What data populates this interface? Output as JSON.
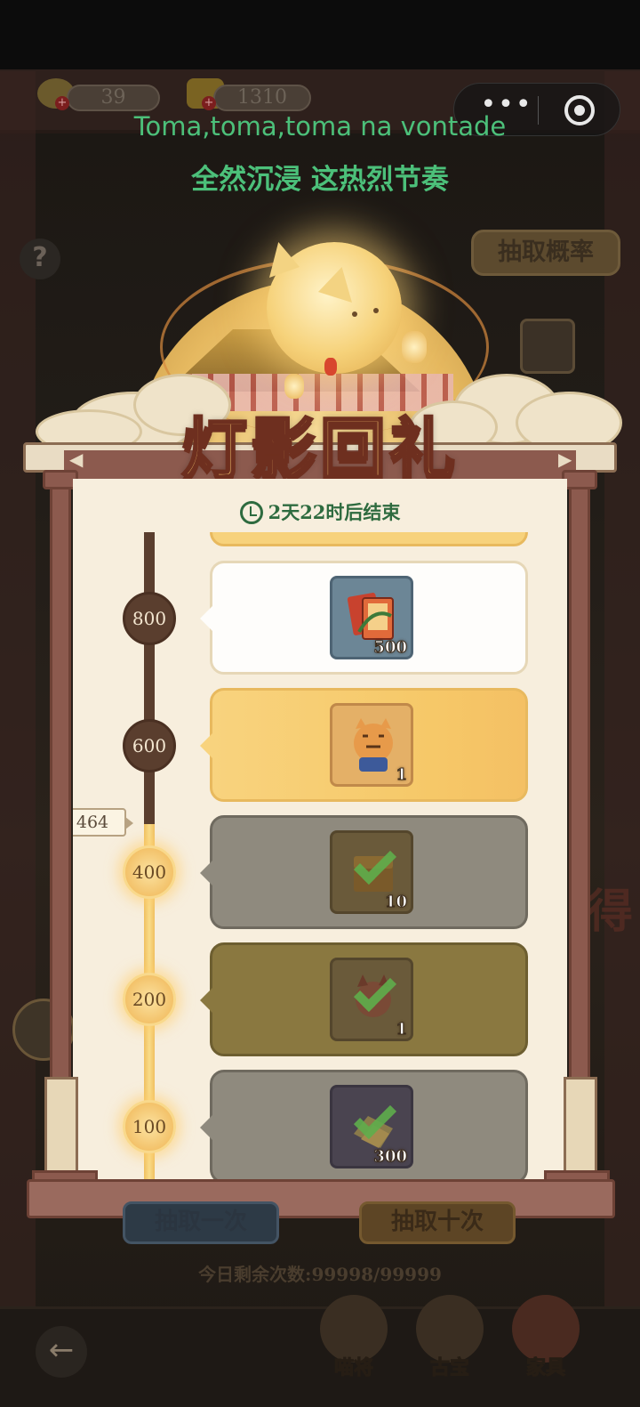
{
  "resources": {
    "fish_count": "39",
    "gold_count": "1310",
    "plus_symbol": "+"
  },
  "capsule": {
    "more_glyph": "•••",
    "close_glyph": ""
  },
  "lyrics": {
    "line1": "Toma,toma,toma na vontade",
    "line2": "全然沉浸 这热烈节奏"
  },
  "help_glyph": "?",
  "probability_button": "抽取概率",
  "side_text": "得",
  "panel": {
    "title": "灯影回礼",
    "timer_text": "2天22时后结束",
    "current_progress": "464",
    "milestones": [
      {
        "value": "800",
        "state": "locked",
        "card_style": "white",
        "item": "card-pack",
        "count": "500"
      },
      {
        "value": "600",
        "state": "locked",
        "card_style": "yellow",
        "item": "tiger-cat",
        "count": "1"
      },
      {
        "value": "400",
        "state": "claimed",
        "card_style": "grey",
        "item": "chest",
        "count": "10"
      },
      {
        "value": "200",
        "state": "claimed",
        "card_style": "olive",
        "item": "fox-cat",
        "count": "1"
      },
      {
        "value": "100",
        "state": "claimed",
        "card_style": "grey",
        "item": "gold-ingot",
        "count": "300"
      }
    ]
  },
  "bottom": {
    "draw_once": "抽取一次",
    "draw_ten": "抽取十次",
    "remaining": "今日剩余次数:99998/99999",
    "back_glyph": "←",
    "nav": [
      {
        "label": "喵将",
        "icon": "cat-general-icon"
      },
      {
        "label": "古宝",
        "icon": "treasure-icon"
      },
      {
        "label": "家具",
        "icon": "furniture-icon"
      }
    ]
  },
  "colors": {
    "accent_green": "#2e6b3f",
    "gold": "#f3c26a",
    "frame_brown": "#8c5a4e"
  }
}
